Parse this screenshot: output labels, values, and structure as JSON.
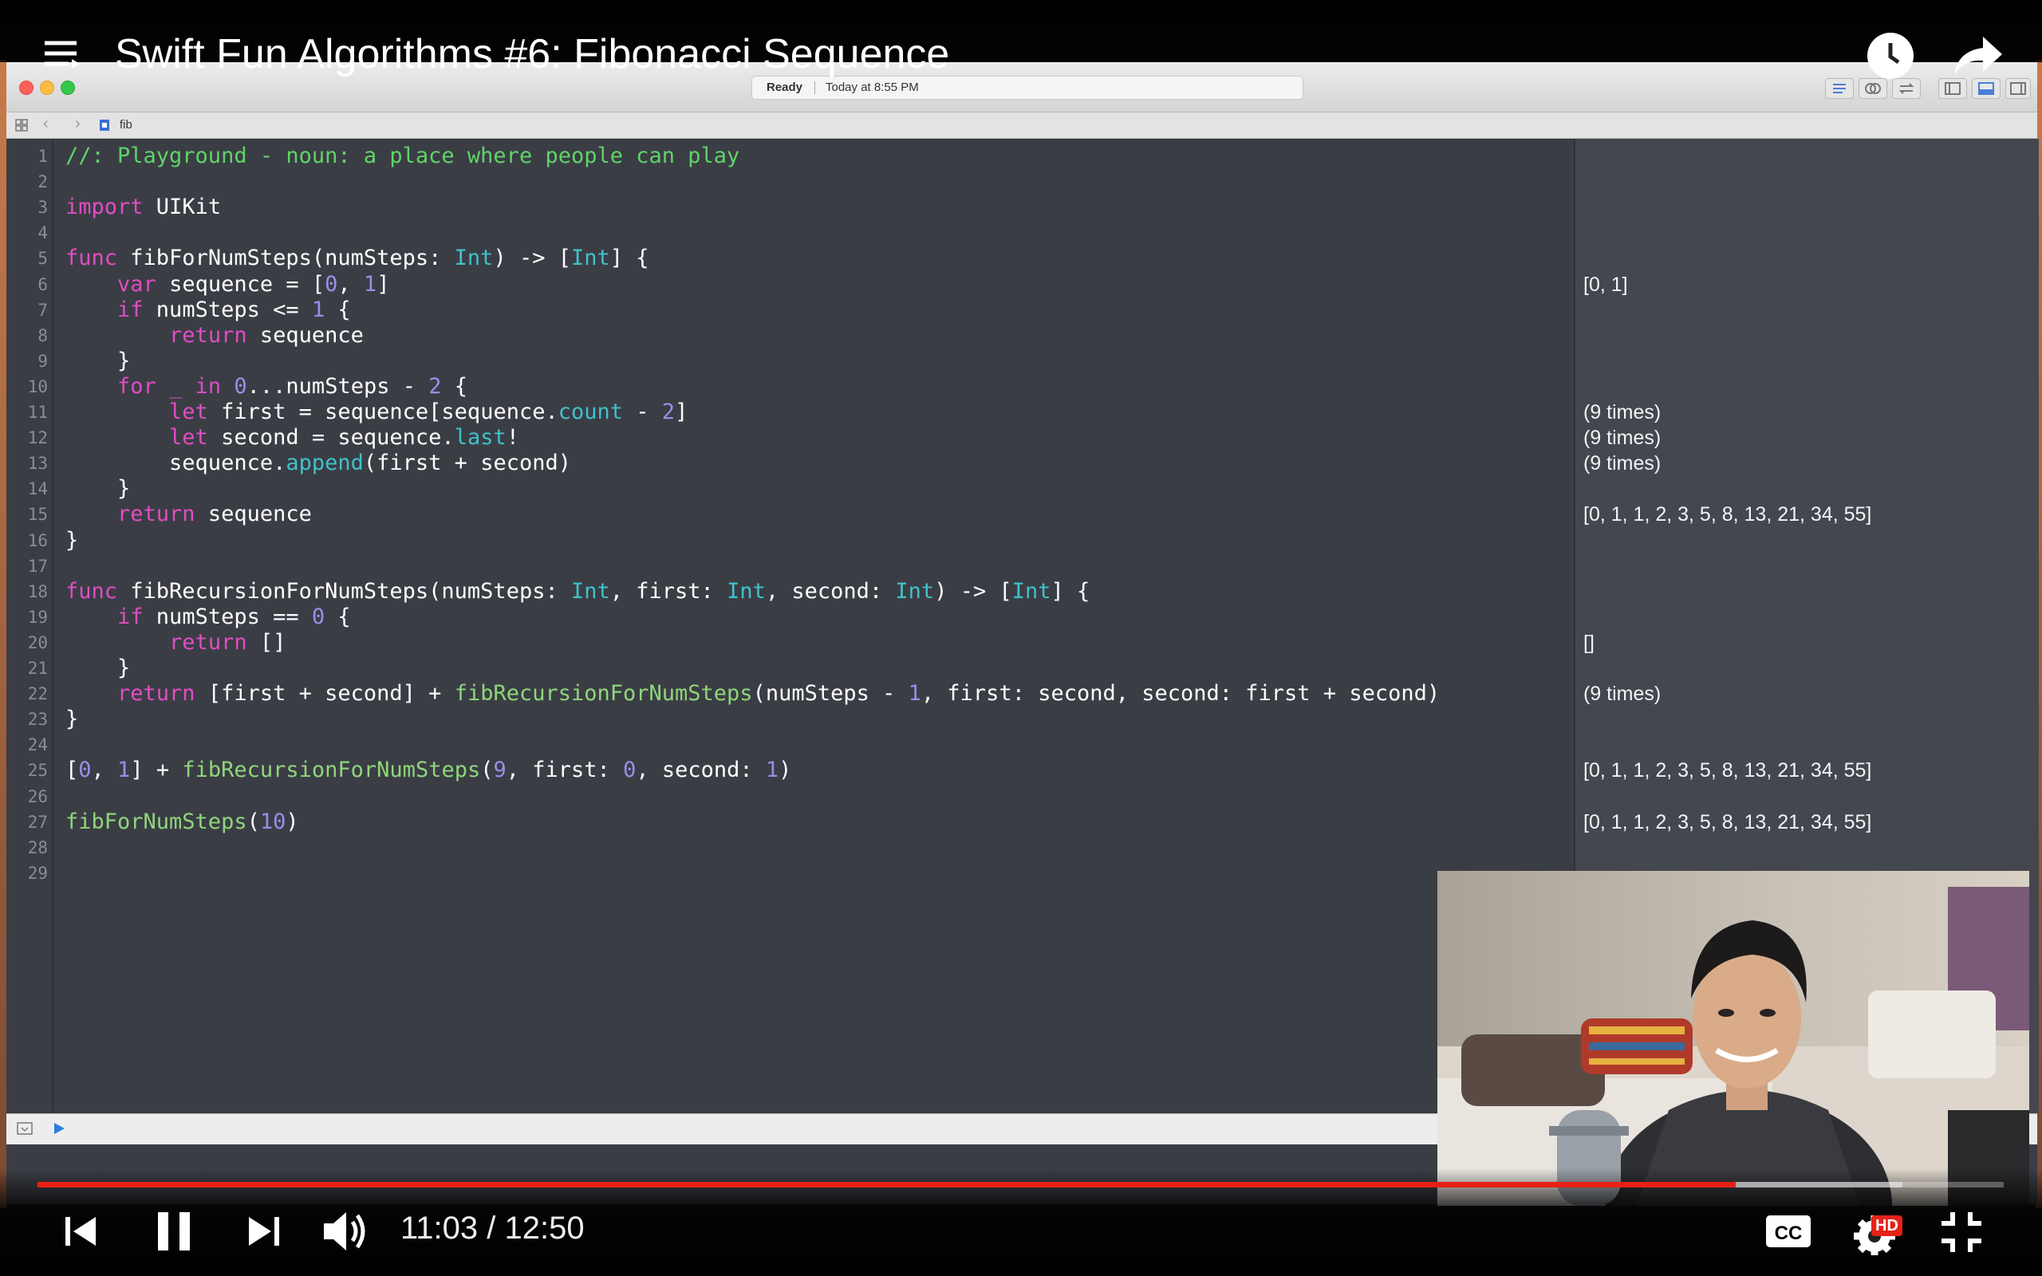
{
  "video": {
    "title": "Swift Fun Algorithms #6: Fibonacci Sequence",
    "time_display": "11:03 / 12:50",
    "progress": 0.8637,
    "buffered": 0.9484,
    "progress_color": "#e62117",
    "hd_badge": "HD",
    "cc_label": "CC"
  },
  "xcode": {
    "status_state": "Ready",
    "status_time": "Today at 8:55 PM",
    "breadcrumb_file": "fib"
  },
  "code_lines": [
    {
      "n": "1",
      "tokens": [
        [
          "cm",
          "//: Playground - noun: a place where people can play"
        ]
      ],
      "result": ""
    },
    {
      "n": "2",
      "tokens": [],
      "result": ""
    },
    {
      "n": "3",
      "tokens": [
        [
          "kw",
          "import"
        ],
        [
          "tx",
          " UIKit"
        ]
      ],
      "result": ""
    },
    {
      "n": "4",
      "tokens": [],
      "result": ""
    },
    {
      "n": "5",
      "tokens": [
        [
          "kw",
          "func"
        ],
        [
          "tx",
          " fibForNumSteps(numSteps: "
        ],
        [
          "ty",
          "Int"
        ],
        [
          "tx",
          ") -> ["
        ],
        [
          "ty",
          "Int"
        ],
        [
          "tx",
          "] {"
        ]
      ],
      "result": ""
    },
    {
      "n": "6",
      "tokens": [
        [
          "tx",
          "    "
        ],
        [
          "kw",
          "var"
        ],
        [
          "tx",
          " sequence = ["
        ],
        [
          "nm",
          "0"
        ],
        [
          "tx",
          ", "
        ],
        [
          "nm",
          "1"
        ],
        [
          "tx",
          "]"
        ]
      ],
      "result": "[0, 1]"
    },
    {
      "n": "7",
      "tokens": [
        [
          "tx",
          "    "
        ],
        [
          "kw",
          "if"
        ],
        [
          "tx",
          " numSteps <= "
        ],
        [
          "nm",
          "1"
        ],
        [
          "tx",
          " {"
        ]
      ],
      "result": ""
    },
    {
      "n": "8",
      "tokens": [
        [
          "tx",
          "        "
        ],
        [
          "kw",
          "return"
        ],
        [
          "tx",
          " sequence"
        ]
      ],
      "result": ""
    },
    {
      "n": "9",
      "tokens": [
        [
          "tx",
          "    }"
        ]
      ],
      "result": ""
    },
    {
      "n": "10",
      "tokens": [
        [
          "tx",
          "    "
        ],
        [
          "kw",
          "for"
        ],
        [
          "tx",
          " "
        ],
        [
          "kw",
          "_"
        ],
        [
          "tx",
          " "
        ],
        [
          "kw",
          "in"
        ],
        [
          "tx",
          " "
        ],
        [
          "nm",
          "0"
        ],
        [
          "tx",
          "...numSteps - "
        ],
        [
          "nm",
          "2"
        ],
        [
          "tx",
          " {"
        ]
      ],
      "result": ""
    },
    {
      "n": "11",
      "tokens": [
        [
          "tx",
          "        "
        ],
        [
          "kw",
          "let"
        ],
        [
          "tx",
          " first = sequence[sequence."
        ],
        [
          "pr",
          "count"
        ],
        [
          "tx",
          " - "
        ],
        [
          "nm",
          "2"
        ],
        [
          "tx",
          "]"
        ]
      ],
      "result": "(9 times)"
    },
    {
      "n": "12",
      "tokens": [
        [
          "tx",
          "        "
        ],
        [
          "kw",
          "let"
        ],
        [
          "tx",
          " second = sequence."
        ],
        [
          "pr",
          "last"
        ],
        [
          "tx",
          "!"
        ]
      ],
      "result": "(9 times)"
    },
    {
      "n": "13",
      "tokens": [
        [
          "tx",
          "        sequence."
        ],
        [
          "pr",
          "append"
        ],
        [
          "tx",
          "(first + second)"
        ]
      ],
      "result": "(9 times)"
    },
    {
      "n": "14",
      "tokens": [
        [
          "tx",
          "    }"
        ]
      ],
      "result": ""
    },
    {
      "n": "15",
      "tokens": [
        [
          "tx",
          "    "
        ],
        [
          "kw",
          "return"
        ],
        [
          "tx",
          " sequence"
        ]
      ],
      "result": "[0, 1, 1, 2, 3, 5, 8, 13, 21, 34, 55]"
    },
    {
      "n": "16",
      "tokens": [
        [
          "tx",
          "}"
        ]
      ],
      "result": ""
    },
    {
      "n": "17",
      "tokens": [],
      "result": ""
    },
    {
      "n": "18",
      "tokens": [
        [
          "kw",
          "func"
        ],
        [
          "tx",
          " fibRecursionForNumSteps(numSteps: "
        ],
        [
          "ty",
          "Int"
        ],
        [
          "tx",
          ", first: "
        ],
        [
          "ty",
          "Int"
        ],
        [
          "tx",
          ", second: "
        ],
        [
          "ty",
          "Int"
        ],
        [
          "tx",
          ") -> ["
        ],
        [
          "ty",
          "Int"
        ],
        [
          "tx",
          "] {"
        ]
      ],
      "result": ""
    },
    {
      "n": "19",
      "tokens": [
        [
          "tx",
          "    "
        ],
        [
          "kw",
          "if"
        ],
        [
          "tx",
          " numSteps == "
        ],
        [
          "nm",
          "0"
        ],
        [
          "tx",
          " {"
        ]
      ],
      "result": ""
    },
    {
      "n": "20",
      "tokens": [
        [
          "tx",
          "        "
        ],
        [
          "kw",
          "return"
        ],
        [
          "tx",
          " []"
        ]
      ],
      "result": "[]"
    },
    {
      "n": "21",
      "tokens": [
        [
          "tx",
          "    }"
        ]
      ],
      "result": ""
    },
    {
      "n": "22",
      "tokens": [
        [
          "tx",
          "    "
        ],
        [
          "kw",
          "return"
        ],
        [
          "tx",
          " [first + second] + "
        ],
        [
          "fn",
          "fibRecursionForNumSteps"
        ],
        [
          "tx",
          "(numSteps - "
        ],
        [
          "nm",
          "1"
        ],
        [
          "tx",
          ", first: second, second: first + second)"
        ]
      ],
      "result": "(9 times)"
    },
    {
      "n": "23",
      "tokens": [
        [
          "tx",
          "}"
        ]
      ],
      "result": ""
    },
    {
      "n": "24",
      "tokens": [],
      "result": ""
    },
    {
      "n": "25",
      "tokens": [
        [
          "tx",
          "["
        ],
        [
          "nm",
          "0"
        ],
        [
          "tx",
          ", "
        ],
        [
          "nm",
          "1"
        ],
        [
          "tx",
          "] + "
        ],
        [
          "fn",
          "fibRecursionForNumSteps"
        ],
        [
          "tx",
          "("
        ],
        [
          "nm",
          "9"
        ],
        [
          "tx",
          ", first: "
        ],
        [
          "nm",
          "0"
        ],
        [
          "tx",
          ", second: "
        ],
        [
          "nm",
          "1"
        ],
        [
          "tx",
          ")"
        ]
      ],
      "result": "[0, 1, 1, 2, 3, 5, 8, 13, 21, 34, 55]"
    },
    {
      "n": "26",
      "tokens": [],
      "result": ""
    },
    {
      "n": "27",
      "tokens": [
        [
          "fn",
          "fibForNumSteps"
        ],
        [
          "tx",
          "("
        ],
        [
          "nm",
          "10"
        ],
        [
          "tx",
          ")"
        ]
      ],
      "result": "[0, 1, 1, 2, 3, 5, 8, 13, 21, 34, 55]"
    },
    {
      "n": "28",
      "tokens": [],
      "result": ""
    },
    {
      "n": "29",
      "tokens": [],
      "result": ""
    }
  ],
  "icons": [
    "menu-icon",
    "play-queue-icon",
    "watch-later-clock-icon",
    "share-arrow-icon",
    "skip-previous-icon",
    "pause-icon",
    "skip-next-icon",
    "volume-icon",
    "closed-captions-icon",
    "settings-gear-icon",
    "exit-fullscreen-icon"
  ]
}
